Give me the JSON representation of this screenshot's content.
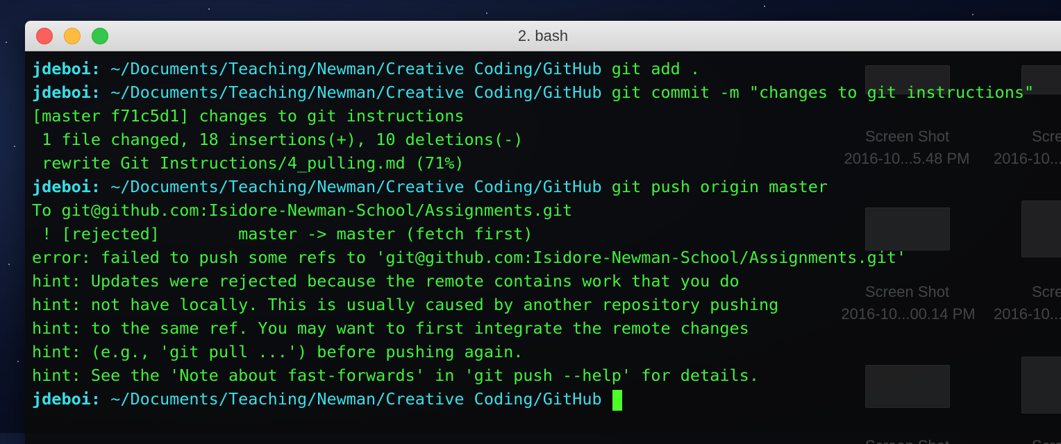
{
  "window": {
    "title": "2. bash"
  },
  "prompt": {
    "user": "jdeboi:",
    "path": "~/Documents/Teaching/Newman/Creative Coding/GitHub"
  },
  "colors": {
    "prompt": "#37e0e8",
    "output": "#3ff23a",
    "cursor": "#4dff2a"
  },
  "lines": [
    {
      "kind": "command",
      "command": "git add ."
    },
    {
      "kind": "command",
      "command": "git commit -m \"changes to git instructions\""
    },
    {
      "kind": "output",
      "text": "[master f71c5d1] changes to git instructions"
    },
    {
      "kind": "output",
      "text": " 1 file changed, 18 insertions(+), 10 deletions(-)"
    },
    {
      "kind": "output",
      "text": " rewrite Git Instructions/4_pulling.md (71%)"
    },
    {
      "kind": "command",
      "command": "git push origin master"
    },
    {
      "kind": "output",
      "text": "To git@github.com:Isidore-Newman-School/Assignments.git"
    },
    {
      "kind": "output",
      "text": " ! [rejected]        master -> master (fetch first)"
    },
    {
      "kind": "output",
      "text": "error: failed to push some refs to 'git@github.com:Isidore-Newman-School/Assignments.git'"
    },
    {
      "kind": "output",
      "text": "hint: Updates were rejected because the remote contains work that you do"
    },
    {
      "kind": "output",
      "text": "hint: not have locally. This is usually caused by another repository pushing"
    },
    {
      "kind": "output",
      "text": "hint: to the same ref. You may want to first integrate the remote changes"
    },
    {
      "kind": "output",
      "text": "hint: (e.g., 'git pull ...') before pushing again."
    },
    {
      "kind": "output",
      "text": "hint: See the 'Note about fast-forwards' in 'git push --help' for details."
    },
    {
      "kind": "command",
      "command": "",
      "cursor": true
    }
  ],
  "desktop_icons": [
    {
      "name": "Screen Shot",
      "date": "2016-10...5.48 PM"
    },
    {
      "name": "Screen",
      "date": "2016-10..."
    },
    {
      "name": "Screen Shot",
      "date": "2016-10...00.14 PM"
    },
    {
      "name": "Screen",
      "date": "2016-10..."
    },
    {
      "name": "Screen Shot",
      "date": ""
    },
    {
      "name": "Screen",
      "date": ""
    }
  ]
}
